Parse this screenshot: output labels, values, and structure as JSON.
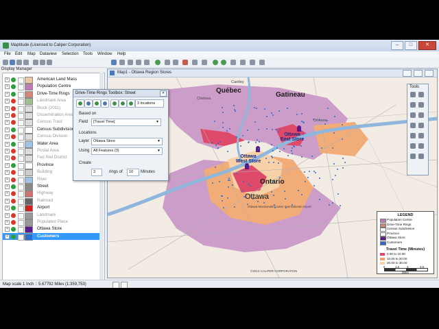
{
  "app": {
    "title": "Maptitude (Licensed to Caliper Corporation)"
  },
  "menu": [
    "File",
    "Edit",
    "Map",
    "Dataview",
    "Selection",
    "Tools",
    "Window",
    "Help"
  ],
  "display_manager": {
    "title": "Display Manager",
    "layers": [
      {
        "name": "American Land Mass",
        "visible": true,
        "dim": false,
        "sym": "#e8c9a4"
      },
      {
        "name": "Population Centre",
        "visible": true,
        "dim": false,
        "sym": "#c07ab8"
      },
      {
        "name": "Drive-Time Rings",
        "visible": true,
        "dim": false,
        "sym": "#d08878"
      },
      {
        "name": "Landmark Area",
        "visible": false,
        "dim": true,
        "sym": "#9fbf8f"
      },
      {
        "name": "Block (2011)",
        "visible": false,
        "dim": true,
        "sym": "#dddddd"
      },
      {
        "name": "Dissemination Area",
        "visible": false,
        "dim": true,
        "sym": "#dddddd"
      },
      {
        "name": "Census Tract",
        "visible": false,
        "dim": true,
        "sym": "#dddddd"
      },
      {
        "name": "Census Subdivision",
        "visible": true,
        "dim": false,
        "sym": "#ffffff"
      },
      {
        "name": "Census Division",
        "visible": false,
        "dim": true,
        "sym": "#dddddd"
      },
      {
        "name": "Water Area",
        "visible": true,
        "dim": false,
        "sym": "#9dc3e6"
      },
      {
        "name": "Postal Area",
        "visible": false,
        "dim": true,
        "sym": "#dddddd"
      },
      {
        "name": "Fed Riel District",
        "visible": false,
        "dim": true,
        "sym": "#dddddd"
      },
      {
        "name": "Province",
        "visible": true,
        "dim": false,
        "sym": "#ffffff"
      },
      {
        "name": "Building",
        "visible": false,
        "dim": true,
        "sym": "#cccccc"
      },
      {
        "name": "River",
        "visible": false,
        "dim": true,
        "sym": "#9dc3e6"
      },
      {
        "name": "Street",
        "visible": true,
        "dim": false,
        "sym": "#888888"
      },
      {
        "name": "Highway",
        "visible": false,
        "dim": true,
        "sym": "#d07070"
      },
      {
        "name": "Railroad",
        "visible": false,
        "dim": true,
        "sym": "#666666"
      },
      {
        "name": "Airport",
        "visible": true,
        "dim": false,
        "sym": "#d02020"
      },
      {
        "name": "Landmark",
        "visible": false,
        "dim": true,
        "sym": "#999999"
      },
      {
        "name": "Populated Place",
        "visible": false,
        "dim": true,
        "sym": "#999999"
      },
      {
        "name": "Ottawa Store",
        "visible": true,
        "dim": false,
        "sym": "#5a1a8a"
      },
      {
        "name": "Customers",
        "visible": true,
        "dim": false,
        "sym": "#2a6fd0",
        "selected": true
      }
    ]
  },
  "map_window": {
    "title": "Map1 - Ottawa Region Stores",
    "labels": {
      "gatineau": "Gatineau",
      "quebec": "Québec",
      "ontario": "Ontario",
      "ottawa": "Ottawa",
      "chelsea": "Chelsea",
      "cantley": "Cantley",
      "east_store": "Ottawa\nEast Store",
      "west_store": "Ottawa\nWest Store",
      "airport": "Ottawa Macdonald-Cartier International Airport",
      "orleans": "Orléans",
      "copyright": "©2013 CALIPER CORPORATION"
    }
  },
  "toolbox": {
    "title": "Drive-Time Rings Toolbox: Street",
    "locations_count": "3 locations",
    "based_on_label": "Based on",
    "field_label": "Field",
    "field_value": "[Travel Time]",
    "locations_label": "Locations",
    "layer_label": "Layer",
    "layer_value": "Ottawa Store",
    "using_label": "Using",
    "using_value": "All Features (3)",
    "create_label": "Create",
    "rings_value": "3",
    "rings_of_label": "rings of",
    "minutes_value": "10",
    "minutes_label": "Minutes"
  },
  "tools_panel": {
    "title": "Tools"
  },
  "legend": {
    "title": "LEGEND",
    "items": [
      {
        "label": "Population Centre",
        "color": "#c07ab8"
      },
      {
        "label": "Drive-Time Rings",
        "color": "#d08878"
      },
      {
        "label": "Census Subdivision",
        "color": "#ffffff"
      },
      {
        "label": "Province",
        "color": "#ffffff"
      },
      {
        "label": "Ottawa Store",
        "color": "#5a1a8a"
      },
      {
        "label": "Customers",
        "color": "#2a6fd0"
      }
    ],
    "travel_title": "Travel Time (Minutes)",
    "bands": [
      {
        "label": "0.00 to 10.00",
        "color": "#d64a6a"
      },
      {
        "label": "10.00 to 20.00",
        "color": "#f0a070"
      },
      {
        "label": "20.00 to 30.00",
        "color": "#f7d1a8"
      }
    ],
    "scale_labels": [
      "0",
      "1.5",
      "3",
      "4.5"
    ],
    "scale_unit": "Miles"
  },
  "status": {
    "text": "Map scale 1 Inch :: 5.67792 Miles (1:359,753)"
  }
}
